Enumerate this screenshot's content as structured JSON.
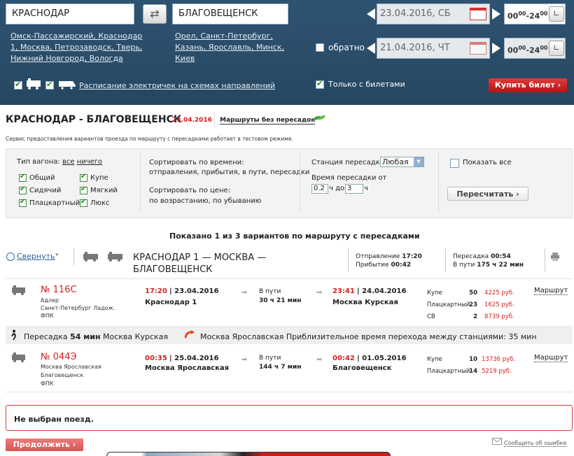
{
  "search": {
    "from": "КРАСНОДАР",
    "to": "БЛАГОВЕЩЕНСК",
    "from_suggestions": [
      "Омск-Пассажирский",
      "Краснодар 1",
      "Москва",
      "Петрозаводск",
      "Тверь",
      "Нижний Новгород",
      "Вологда"
    ],
    "from_lines": [
      "Омск-Пассажирский, Краснодар",
      "1, Москва, Петрозаводск, Тверь,",
      "Нижний Новгород, Вологда"
    ],
    "to_lines": [
      "Орел, Санкт-Петербург,",
      "Казань, Ярославль, Минск,",
      "Киев"
    ],
    "date_there": "23.04.2016, СБ",
    "date_back": "21.04.2016, ЧТ",
    "time_from": "00",
    "time_from_sup": "00",
    "time_dash": "-",
    "time_to": "24",
    "time_to_sup": "00",
    "return_label": "обратно",
    "schedule_link": "Расписание электричек на схемах направлений",
    "only_with_tickets": "Только с билетами",
    "buy_button": "Купить билет ›",
    "swap_icon": "⇄",
    "clock_icon": "∟"
  },
  "header": {
    "route_title": "КРАСНОДАР - БЛАГОВЕЩЕНСК",
    "route_date": "23.04.2016",
    "no_transfer_link": "Маршруты без пересадок",
    "notice": "Сервис предоставления вариантов проезда по маршруту с пересадками работает в тестовом режиме."
  },
  "filters": {
    "car_type_label": "Тип вагона:",
    "all": "все",
    "none": "ничего",
    "types": [
      "Общий",
      "Купе",
      "Сидячий",
      "Мягкий",
      "Плацкартный",
      "Люкс"
    ],
    "sort_time_label": "Сортировать по времени:",
    "sort_time_opts": "отправления, прибытия, в пути, пересадки",
    "sort_price_label": "Сортировать по цене:",
    "sort_price_opts": "по возрастанию, по убыванию",
    "transfer_station_label": "Станция пересадки:",
    "transfer_station_value": "Любая",
    "transfer_time_label": "Время пересадки от",
    "from_hours": "0.2",
    "to_word": "ч до",
    "to_hours": "3",
    "hours_unit": "ч",
    "show_all": "Показать все",
    "recalc": "Пересчитать ›"
  },
  "results": {
    "shown_text": "Показано 1 из 3 вариантов по маршруту с пересадками",
    "collapse": "Свернуть",
    "route": "КРАСНОДАР 1 — МОСКВА — БЛАГОВЕЩЕНСК",
    "route_line1": "КРАСНОДАР 1 — МОСКВА —",
    "route_line2": "БЛАГОВЕЩЕНСК",
    "departure_label": "Отправление",
    "departure_time": "17:20",
    "arrival_label": "Прибытие",
    "arrival_time": "00:42",
    "transfer_label": "Пересадка",
    "transfer_time": "00:54",
    "total_label": "В пути",
    "total_time": "175 ч 22 мин"
  },
  "trains": [
    {
      "number": "№ 116С",
      "route": [
        "Адлер",
        "Санкт-Петербург Ладож.",
        "ФПК"
      ],
      "dep_time": "17:20",
      "dep_date": "| 23.04.2016",
      "dep_station": "Краснодар 1",
      "travel_label": "В пути",
      "travel": "30 ч 21 мин",
      "arr_time": "23:41",
      "arr_date": "| 24.04.2016",
      "arr_station": "Москва Курская",
      "seats": [
        {
          "type": "Купе",
          "count": "50",
          "price": "4225 руб."
        },
        {
          "type": "Плацкартный",
          "count": "23",
          "price": "1625 руб."
        },
        {
          "type": "СВ",
          "count": "2",
          "price": "8739 руб."
        }
      ],
      "route_link": "Маршрут"
    },
    {
      "number": "№ 044Э",
      "route": [
        "Москва Ярославская",
        "Благовещенск",
        "ФПК"
      ],
      "dep_time": "00:35",
      "dep_date": "| 25.04.2016",
      "dep_station": "Москва Ярославская",
      "travel_label": "В пути",
      "travel": "144 ч 7 мин",
      "arr_time": "00:42",
      "arr_date": "| 01.05.2016",
      "arr_station": "Благовещенск",
      "seats": [
        {
          "type": "Купе",
          "count": "10",
          "price": "13736 руб."
        },
        {
          "type": "Плацкартный",
          "count": "14",
          "price": "5219 руб."
        }
      ],
      "route_link": "Маршрут"
    }
  ],
  "transfer_bar": {
    "prefix": "Пересадка",
    "duration": "54 мин",
    "station": "Москва Курская",
    "info": "Москва Ярославская Приблизительное время перехода между станциями: 35 мин"
  },
  "footer": {
    "no_train": "Не выбран поезд.",
    "continue": "Продолжить ›",
    "report": "Сообщить об ошибке"
  },
  "colors": {
    "accent_red": "#d62020",
    "top_bg": "#2b4d6a"
  }
}
